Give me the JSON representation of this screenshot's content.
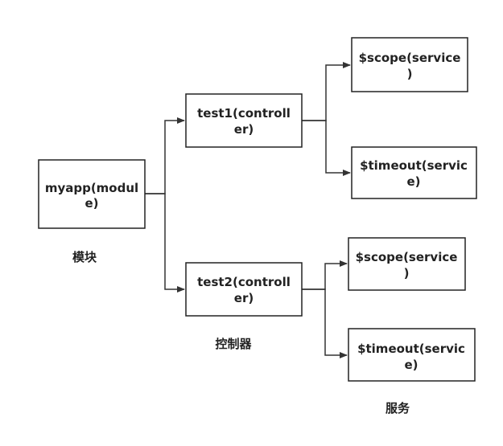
{
  "diagram": {
    "nodes": {
      "module": [
        "myapp(modul",
        "e)"
      ],
      "controller1": [
        "test1(controll",
        "er)"
      ],
      "controller2": [
        "test2(controll",
        "er)"
      ],
      "scope1": [
        "$scope(service",
        ")"
      ],
      "timeout1": [
        "$timeout(servic",
        "e)"
      ],
      "scope2": [
        "$scope(service",
        ")"
      ],
      "timeout2": [
        "$timeout(servic",
        "e)"
      ]
    },
    "captions": {
      "module": "模块",
      "controller": "控制器",
      "service": "服务"
    }
  }
}
